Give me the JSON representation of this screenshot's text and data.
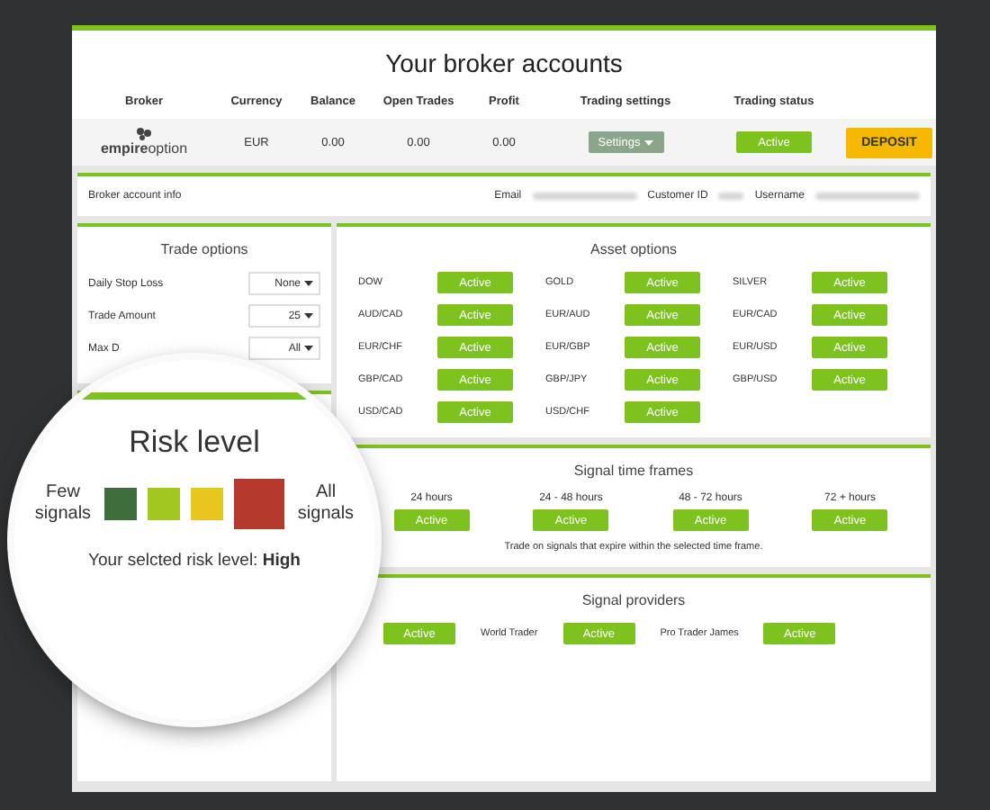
{
  "title": "Your broker accounts",
  "columns": [
    "Broker",
    "Currency",
    "Balance",
    "Open Trades",
    "Profit",
    "Trading settings",
    "Trading status"
  ],
  "account": {
    "logo": "**empire**option",
    "currency": "EUR",
    "balance": "0.00",
    "open_trades": "0.00",
    "profit": "0.00",
    "settings_button": "Settings",
    "status_button": "Active",
    "deposit_button": "DEPOSIT"
  },
  "info_bar": {
    "label": "Broker account info",
    "fields": [
      "Email",
      "Customer ID",
      "Username"
    ]
  },
  "trade_options": {
    "title": "Trade options",
    "rows": [
      {
        "label": "Daily Stop Loss",
        "value": "None"
      },
      {
        "label": "Trade Amount",
        "value": "25"
      },
      {
        "label": "Max D",
        "value": "All"
      }
    ]
  },
  "asset_options": {
    "title": "Asset options",
    "assets": [
      {
        "name": "DOW",
        "status": "Active"
      },
      {
        "name": "GOLD",
        "status": "Active"
      },
      {
        "name": "SILVER",
        "status": "Active"
      },
      {
        "name": "AUD/CAD",
        "status": "Active"
      },
      {
        "name": "EUR/AUD",
        "status": "Active"
      },
      {
        "name": "EUR/CAD",
        "status": "Active"
      },
      {
        "name": "EUR/CHF",
        "status": "Active"
      },
      {
        "name": "EUR/GBP",
        "status": "Active"
      },
      {
        "name": "EUR/USD",
        "status": "Active"
      },
      {
        "name": "GBP/CAD",
        "status": "Active"
      },
      {
        "name": "GBP/JPY",
        "status": "Active"
      },
      {
        "name": "GBP/USD",
        "status": "Active"
      },
      {
        "name": "USD/CAD",
        "status": "Active"
      },
      {
        "name": "USD/CHF",
        "status": "Active"
      }
    ]
  },
  "signal_time_frames": {
    "title": "Signal time frames",
    "frames": [
      {
        "label": "24 hours",
        "status": "Active"
      },
      {
        "label": "24 - 48 hours",
        "status": "Active"
      },
      {
        "label": "48 - 72 hours",
        "status": "Active"
      },
      {
        "label": "72 + hours",
        "status": "Active"
      }
    ],
    "note": "Trade on signals that expire within the selected time frame."
  },
  "signal_providers": {
    "title": "Signal providers",
    "providers": [
      {
        "status": "Active"
      },
      {
        "name": "World Trader",
        "status": "Active"
      },
      {
        "name": "Pro Trader James",
        "status": "Active"
      }
    ]
  },
  "risk_level": {
    "title": "Risk level",
    "low_label": "Few signals",
    "high_label": "All signals",
    "levels": [
      {
        "color": "#3d6e3c",
        "selected": false
      },
      {
        "color": "#a2c81f",
        "selected": false
      },
      {
        "color": "#e8c51f",
        "selected": false
      },
      {
        "color": "#b43a2e",
        "selected": true
      }
    ],
    "summary": "Your selcted risk level: **High**"
  }
}
